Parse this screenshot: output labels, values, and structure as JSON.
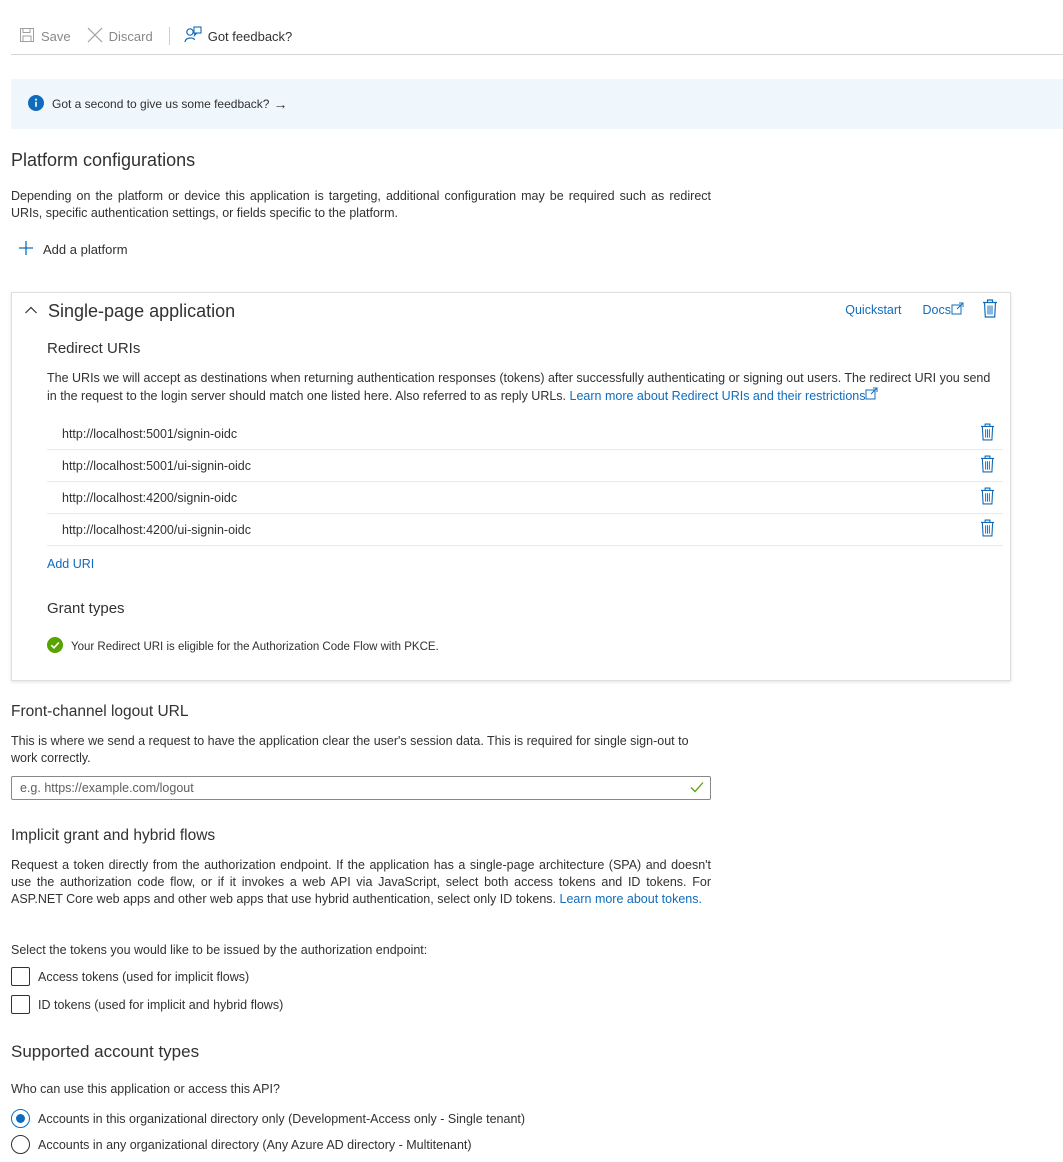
{
  "toolbar": {
    "save_label": "Save",
    "discard_label": "Discard",
    "feedback_label": "Got feedback?"
  },
  "banner": {
    "text": "Got a second to give us some feedback?",
    "arrow": "→"
  },
  "platform": {
    "title": "Platform configurations",
    "description": "Depending on the platform or device this application is targeting, additional configuration may be required such as redirect URIs, specific authentication settings, or fields specific to the platform.",
    "add_label": "Add a platform"
  },
  "spa": {
    "title": "Single-page application",
    "quickstart_label": "Quickstart",
    "docs_label": "Docs",
    "redirect_heading": "Redirect URIs",
    "redirect_text": "The URIs we will accept as destinations when returning authentication responses (tokens) after successfully authenticating or signing out users. The redirect URI you send in the request to the login server should match one listed here. Also referred to as reply URLs.",
    "redirect_link": "Learn more about Redirect URIs and their restrictions",
    "uris": [
      "http://localhost:5001/signin-oidc",
      "http://localhost:5001/ui-signin-oidc",
      "http://localhost:4200/signin-oidc",
      "http://localhost:4200/ui-signin-oidc"
    ],
    "add_uri_label": "Add URI",
    "grant_heading": "Grant types",
    "grant_status": "Your Redirect URI is eligible for the Authorization Code Flow with PKCE."
  },
  "logout": {
    "title": "Front-channel logout URL",
    "description": "This is where we send a request to have the application clear the user's session data. This is required for single sign-out to work correctly.",
    "placeholder": "e.g. https://example.com/logout",
    "value": ""
  },
  "implicit": {
    "title": "Implicit grant and hybrid flows",
    "description": "Request a token directly from the authorization endpoint. If the application has a single-page architecture (SPA) and doesn't use the authorization code flow, or if it invokes a web API via JavaScript, select both access tokens and ID tokens. For ASP.NET Core web apps and other web apps that use hybrid authentication, select only ID tokens.",
    "link": "Learn more about tokens.",
    "select_prompt": "Select the tokens you would like to be issued by the authorization endpoint:",
    "options": [
      {
        "label": "Access tokens (used for implicit flows)",
        "checked": false
      },
      {
        "label": "ID tokens (used for implicit and hybrid flows)",
        "checked": false
      }
    ]
  },
  "accounts": {
    "title": "Supported account types",
    "question": "Who can use this application or access this API?",
    "options": [
      {
        "label": "Accounts in this organizational directory only (Development-Access only - Single tenant)",
        "selected": true
      },
      {
        "label": "Accounts in any organizational directory (Any Azure AD directory - Multitenant)",
        "selected": false
      }
    ]
  },
  "colors": {
    "accent": "#0f6cbd",
    "banner_bg": "#eff6fc",
    "success": "#57a300"
  }
}
